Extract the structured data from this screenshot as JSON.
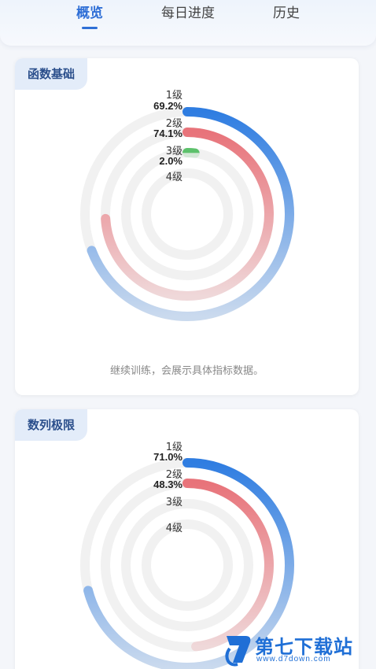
{
  "tabs": [
    {
      "label": "概览",
      "active": true
    },
    {
      "label": "每日进度",
      "active": false
    },
    {
      "label": "历史",
      "active": false
    }
  ],
  "cards": [
    {
      "title": "函数基础",
      "levels": [
        {
          "label": "1级",
          "percent": "69.2%",
          "value": 69.2,
          "color": "#2f7de1"
        },
        {
          "label": "2级",
          "percent": "74.1%",
          "value": 74.1,
          "color": "#e8737a"
        },
        {
          "label": "3级",
          "percent": "2.0%",
          "value": 2.0,
          "color": "#5cc16b"
        },
        {
          "label": "4级",
          "percent": "",
          "value": 0,
          "color": "#cccccc"
        }
      ],
      "hint": "继续训练，会展示具体指标数据。"
    },
    {
      "title": "数列极限",
      "levels": [
        {
          "label": "1级",
          "percent": "71.0%",
          "value": 71.0,
          "color": "#2f7de1"
        },
        {
          "label": "2级",
          "percent": "48.3%",
          "value": 48.3,
          "color": "#e8737a"
        },
        {
          "label": "3级",
          "percent": "",
          "value": 0,
          "color": "#5cc16b"
        },
        {
          "label": "4级",
          "percent": "",
          "value": 0,
          "color": "#cccccc"
        }
      ],
      "hint": ""
    }
  ],
  "watermark": {
    "title": "第七下载站",
    "subtitle": "www.d7down.com"
  },
  "colors": {
    "accent": "#2f6fd6",
    "track": "#f1f1f1"
  }
}
